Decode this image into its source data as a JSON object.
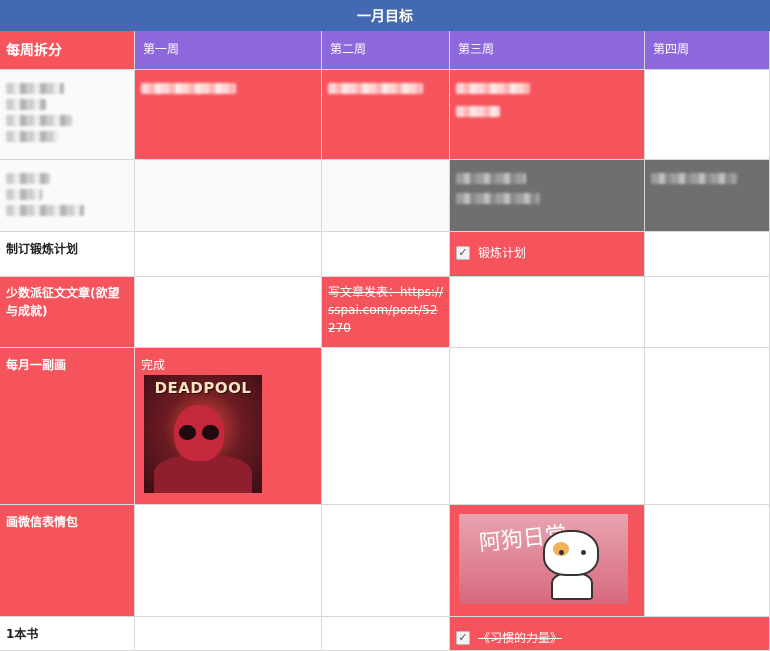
{
  "title": "一月目标",
  "header": {
    "row_label": "每周拆分",
    "weeks": [
      "第一周",
      "第二周",
      "第三周",
      "第四周"
    ]
  },
  "rows": {
    "exercise": {
      "label": "制订锻炼计划",
      "week3_task": "锻炼计划",
      "week3_checked": true
    },
    "article": {
      "label": "少数派征文文章(欲望与成就)",
      "week2_text": "写文章发表：https://sspai.com/post/52270"
    },
    "painting": {
      "label": "每月一副画",
      "week1_status": "完成",
      "week1_image_caption": "DEADPOOL"
    },
    "sticker": {
      "label": "画微信表情包",
      "week3_image_text": "阿狗日常"
    },
    "book": {
      "label": "1本书",
      "week3_task": "《习惯的力量》",
      "week3_checked": true
    }
  },
  "colors": {
    "title_bar": "#4369b2",
    "header_week": "#8d67dc",
    "highlight": "#f6545c",
    "redacted_gray": "#6f6f6f"
  },
  "icons": {
    "checkbox": "check-mark"
  }
}
